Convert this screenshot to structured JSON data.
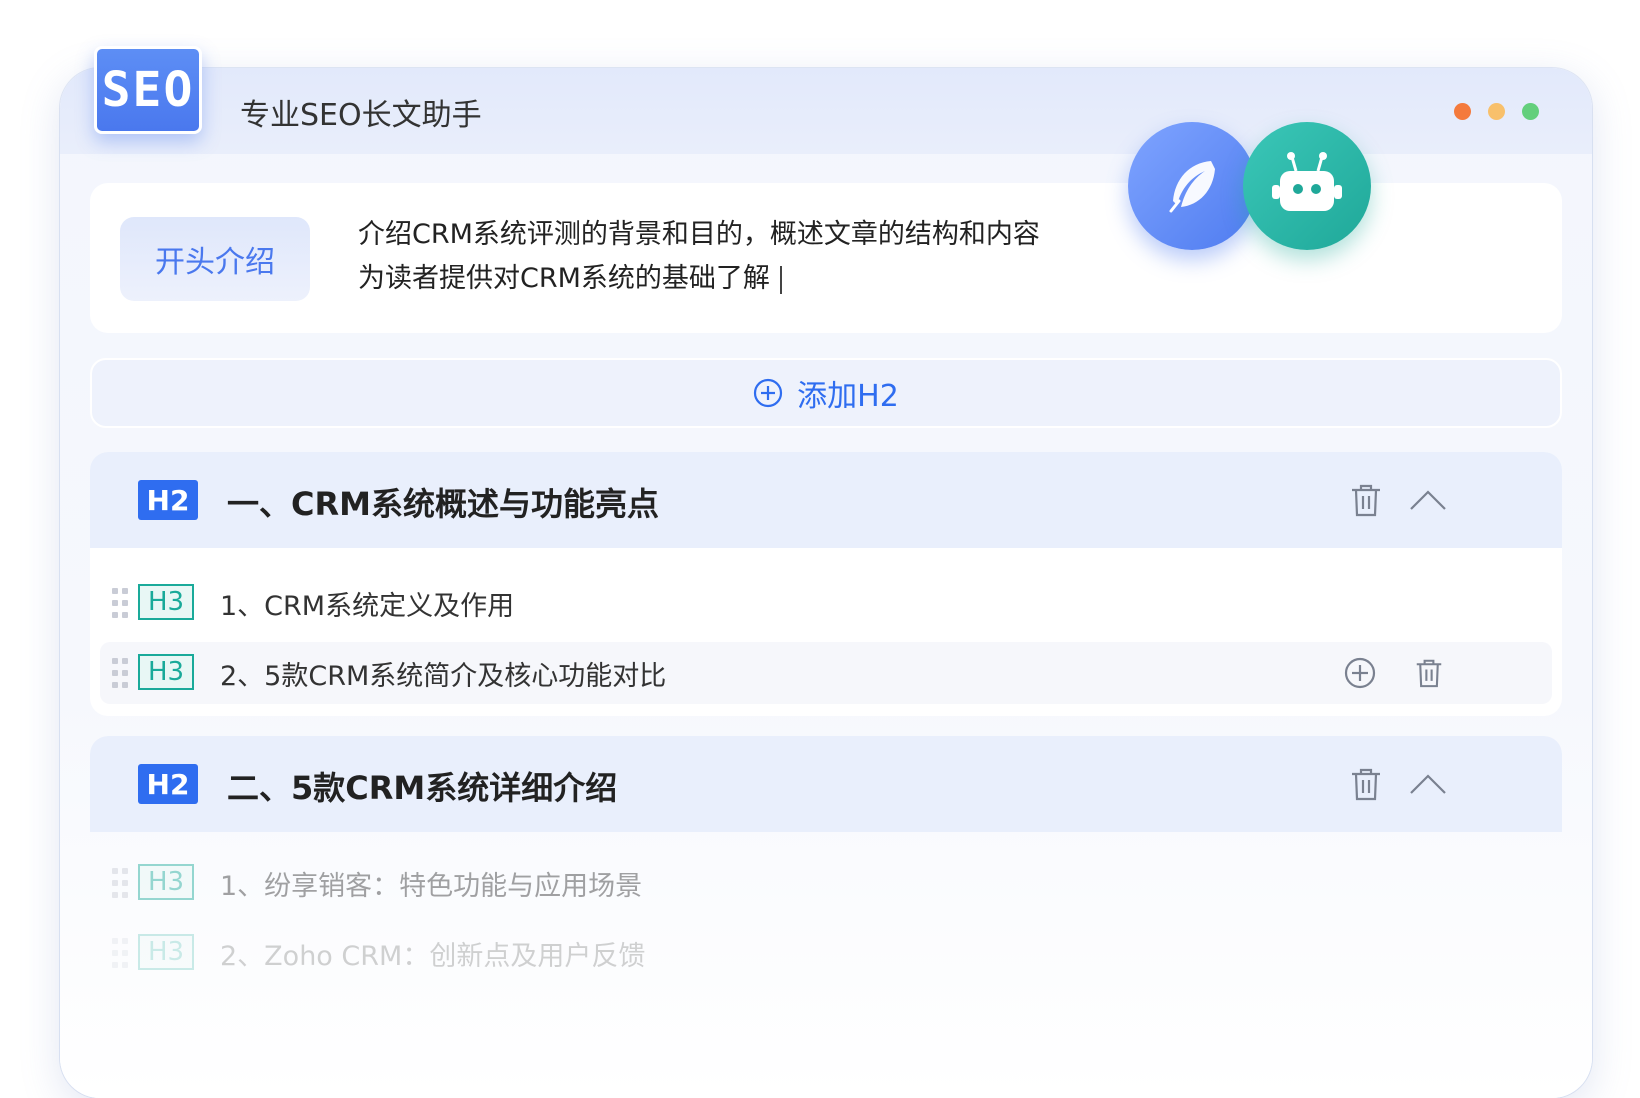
{
  "app": {
    "logo_text": "SEO",
    "title": "专业SEO长文助手",
    "window_dots": [
      "#f47a3c",
      "#f8c06b",
      "#63cf7c"
    ]
  },
  "intro": {
    "tag": "开头介绍",
    "line1": "介绍CRM系统评测的背景和目的，概述文章的结构和内容",
    "line2": "为读者提供对CRM系统的基础了解"
  },
  "add_h2": {
    "label": "添加H2"
  },
  "sections": [
    {
      "tag": "H2",
      "title": "一、CRM系统概述与功能亮点",
      "items": [
        {
          "tag": "H3",
          "title": "1、CRM系统定义及作用"
        },
        {
          "tag": "H3",
          "title": "2、5款CRM系统简介及核心功能对比"
        }
      ]
    },
    {
      "tag": "H2",
      "title": "二、5款CRM系统详细介绍",
      "items": [
        {
          "tag": "H3",
          "title": "1、纷享销客：特色功能与应用场景"
        },
        {
          "tag": "H3",
          "title": "2、Zoho CRM：创新点及用户反馈"
        }
      ]
    }
  ],
  "colors": {
    "accent": "#2f6df0",
    "h3": "#1aaa9a"
  }
}
